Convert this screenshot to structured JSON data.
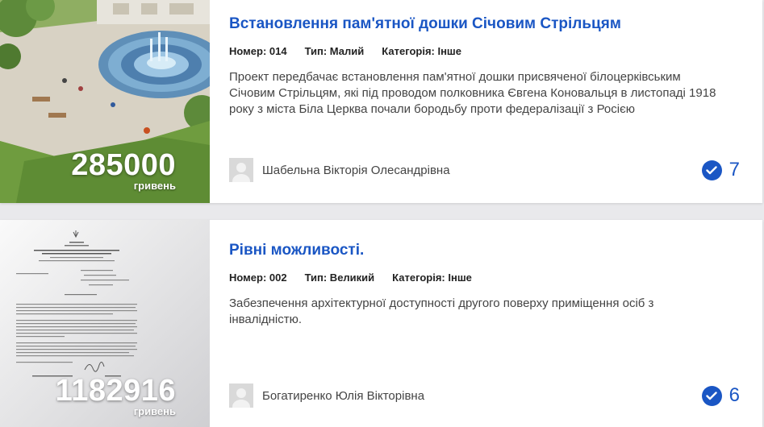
{
  "projects": [
    {
      "amount": "285000",
      "currency": "гривень",
      "title": "Встановлення пам'ятної дошки Січовим Стрільцям",
      "number": "Номер: 014",
      "type": "Тип: Малий",
      "category": "Категорія: Інше",
      "description": "Проект передбачає встановлення пам'ятної дошки присвяченої білоцерківським Січовим Стрільцям, які під проводом полковника Євгена Коновальця в листопаді 1918 року з міста Біла Церква почали бородьбу проти федералізації з Росією",
      "author": "Шабельна Вікторія Олесандрівна",
      "votes": "7",
      "thumb_icon": "park-fountain-render-image"
    },
    {
      "amount": "1182916",
      "currency": "гривень",
      "title": "Рівні можливості.",
      "number": "Номер: 002",
      "type": "Тип: Великий",
      "category": "Категорія: Інше",
      "description": "Забезпечення архітектурної доступності другого поверху приміщення осіб з інвалідністю.",
      "author": "Богатиренко Юлія Вікторівна",
      "votes": "6",
      "thumb_icon": "scanned-letter-document-image"
    }
  ],
  "colors": {
    "accent": "#1a56c4",
    "background": "#e9e9ec"
  }
}
